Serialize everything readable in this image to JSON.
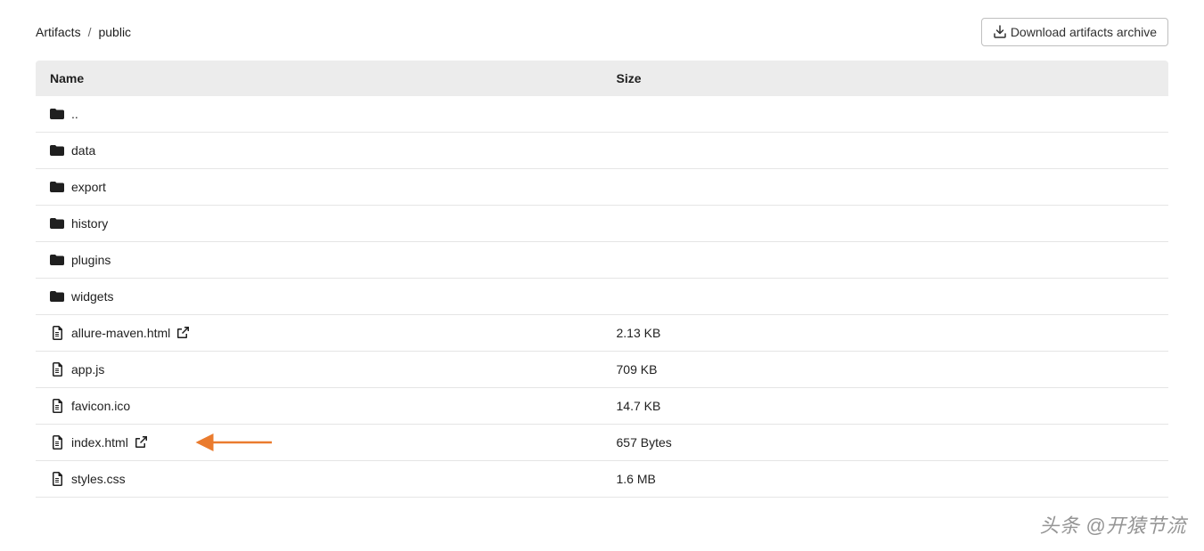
{
  "breadcrumb": {
    "root": "Artifacts",
    "current": "public"
  },
  "actions": {
    "download_label": "Download artifacts archive"
  },
  "table": {
    "headers": {
      "name": "Name",
      "size": "Size"
    },
    "rows": [
      {
        "type": "folder",
        "name": "..",
        "size": "",
        "external": false,
        "annotated": false
      },
      {
        "type": "folder",
        "name": "data",
        "size": "",
        "external": false,
        "annotated": false
      },
      {
        "type": "folder",
        "name": "export",
        "size": "",
        "external": false,
        "annotated": false
      },
      {
        "type": "folder",
        "name": "history",
        "size": "",
        "external": false,
        "annotated": false
      },
      {
        "type": "folder",
        "name": "plugins",
        "size": "",
        "external": false,
        "annotated": false
      },
      {
        "type": "folder",
        "name": "widgets",
        "size": "",
        "external": false,
        "annotated": false
      },
      {
        "type": "file",
        "name": "allure-maven.html",
        "size": "2.13 KB",
        "external": true,
        "annotated": false
      },
      {
        "type": "file",
        "name": "app.js",
        "size": "709 KB",
        "external": false,
        "annotated": false
      },
      {
        "type": "file",
        "name": "favicon.ico",
        "size": "14.7 KB",
        "external": false,
        "annotated": false
      },
      {
        "type": "file",
        "name": "index.html",
        "size": "657 Bytes",
        "external": true,
        "annotated": true
      },
      {
        "type": "file",
        "name": "styles.css",
        "size": "1.6 MB",
        "external": false,
        "annotated": false
      }
    ]
  },
  "watermark": "头条 @开猿节流"
}
